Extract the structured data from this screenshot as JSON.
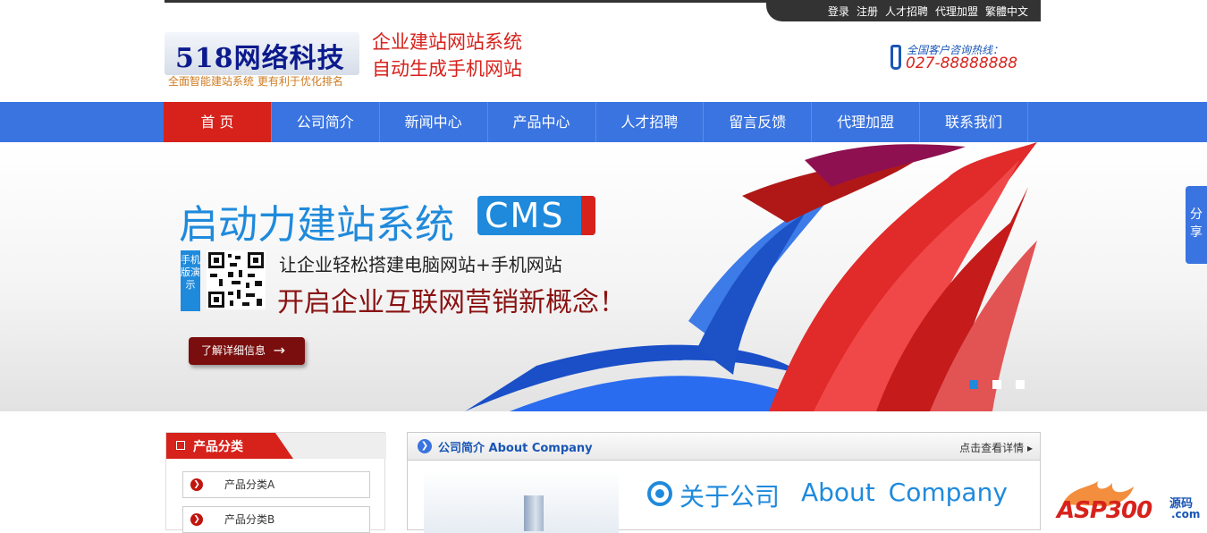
{
  "top_links": [
    "登录",
    "注册",
    "人才招聘",
    "代理加盟",
    "繁體中文"
  ],
  "logo": {
    "text": "518网络科技",
    "tagline": "全面智能建站系统 更有利于优化排名"
  },
  "slogan": {
    "line1": "企业建站网站系统",
    "line2": "自动生成手机网站"
  },
  "hotline": {
    "label": "全国客户咨询热线：",
    "number": "027-88888888"
  },
  "nav": {
    "items": [
      "首 页",
      "公司简介",
      "新闻中心",
      "产品中心",
      "人才招聘",
      "留言反馈",
      "代理加盟",
      "联系我们"
    ],
    "active_index": 0
  },
  "banner": {
    "title": "启动力建站系统",
    "badge": "CMS",
    "badge_side": "skins",
    "mobile_tag": "手机版演示",
    "line1": "让企业轻松搭建电脑网站+手机网站",
    "line2": "开启企业互联网营销新概念！",
    "button": "了解详细信息",
    "slides": 3,
    "active_slide": 0
  },
  "share": {
    "label": "分享"
  },
  "category": {
    "title": "产品分类",
    "items": [
      "产品分类A",
      "产品分类B"
    ]
  },
  "about": {
    "title": "公司简介 About Company",
    "more": "点击查看详情",
    "heading_cn": "关于公司",
    "heading_en": "About Company"
  },
  "watermark": {
    "brand": "ASP300",
    "src": "源码",
    "domain": ".com"
  },
  "colors": {
    "nav_blue": "#3a74e0",
    "active_red": "#d7221c",
    "accent_blue": "#1f8adc"
  }
}
